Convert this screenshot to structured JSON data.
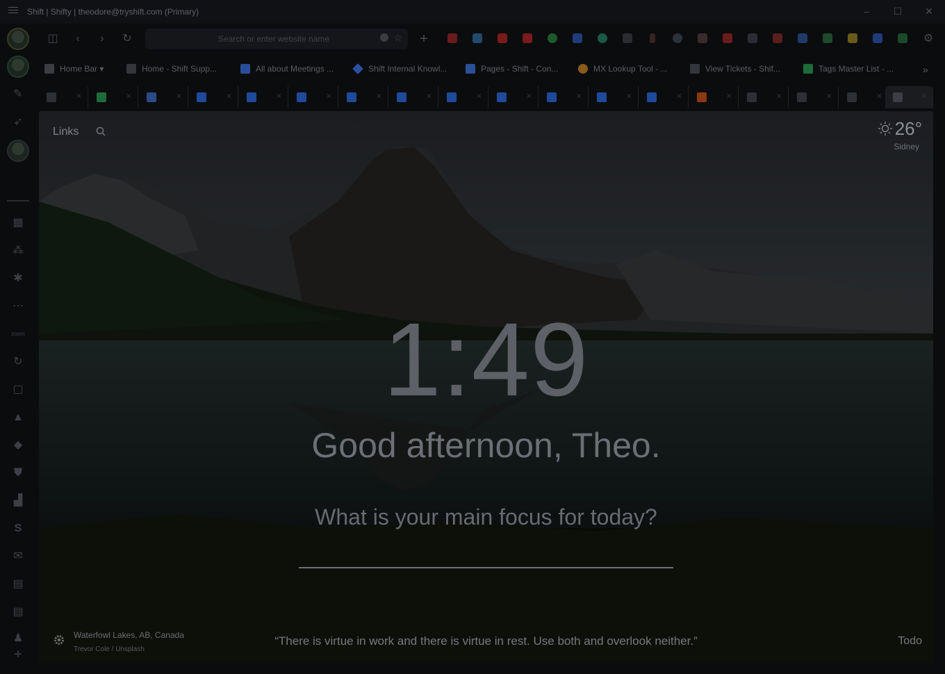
{
  "window": {
    "title": "Shift | Shifty | theodore@tryshift.com (Primary)",
    "minimize_icon": "minimize-icon",
    "maximize_icon": "maximize-icon",
    "close_icon": "close-icon"
  },
  "toolbar": {
    "address_placeholder": "Search or enter website name"
  },
  "bookmarks": [
    {
      "label": "Home Bar",
      "icon": "home-icon",
      "color": "#5a5d63"
    },
    {
      "label": "Home - Shift Supp...",
      "icon": "zendesk-icon",
      "color": "#45484d"
    },
    {
      "label": "All about Meetings ...",
      "icon": "confluence-icon",
      "color": "#2a4f9a"
    },
    {
      "label": "Shift Internal Knowl...",
      "icon": "diamond-icon",
      "color": "#2b4fa0"
    },
    {
      "label": "Pages - Shift - Con...",
      "icon": "confluence-icon",
      "color": "#2a4f9a"
    },
    {
      "label": "MX Lookup Tool - ...",
      "icon": "mx-icon",
      "color": "#8a5a1a"
    },
    {
      "label": "View Tickets - Shif...",
      "icon": "zendesk-icon",
      "color": "#45484d"
    },
    {
      "label": "Tags Master List - ...",
      "icon": "sheets-icon",
      "color": "#1e6b3a"
    }
  ],
  "new_tab": {
    "links_label": "Links",
    "temperature": "26°",
    "weather_location": "Sidney",
    "time": "1:49",
    "greeting": "Good afternoon, Theo.",
    "focus_prompt": "What is your main focus for today?",
    "photo_location": "Waterfowl Lakes, AB, Canada",
    "photo_credit": "Trevor Cole / Unsplash",
    "quote": "“There is virtue in work and there is virtue in rest. Use both and overlook neither.”",
    "todo_label": "Todo"
  }
}
